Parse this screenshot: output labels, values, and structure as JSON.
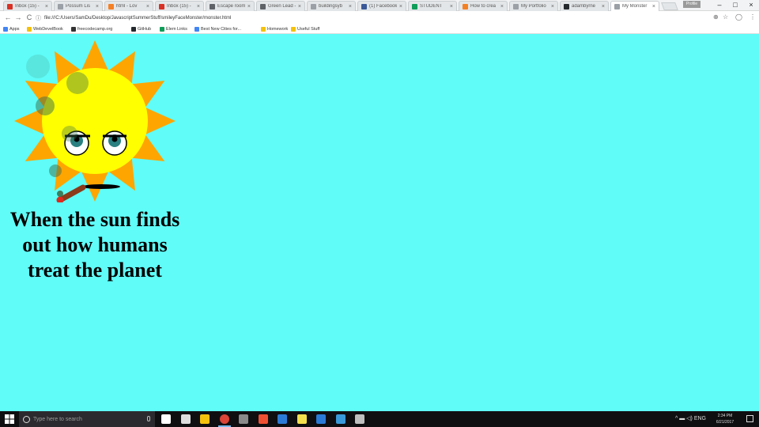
{
  "browser": {
    "tabs": [
      {
        "title": "Inbox (15) -",
        "color": "#d93025"
      },
      {
        "title": "Possum Lis",
        "color": "#9aa0a6"
      },
      {
        "title": "html - Lov",
        "color": "#f48024"
      },
      {
        "title": "Inbox (15) -",
        "color": "#d93025"
      },
      {
        "title": "Escape rooms",
        "color": "#5f6368"
      },
      {
        "title": "Green Lead -",
        "color": "#5f6368"
      },
      {
        "title": "buildingsyb",
        "color": "#9aa0a6"
      },
      {
        "title": "(1) Facebook",
        "color": "#3b5998"
      },
      {
        "title": "STUDENT",
        "color": "#0f9d58"
      },
      {
        "title": "How to crea",
        "color": "#f48024"
      },
      {
        "title": "My Portfolio",
        "color": "#9aa0a6"
      },
      {
        "title": "adambyrne",
        "color": "#24292e"
      },
      {
        "title": "My Monster",
        "color": "#9aa0a6",
        "active": true
      }
    ],
    "profile_label": "Profile",
    "window_controls": {
      "minimize": "–",
      "maximize": "□",
      "close": "×"
    },
    "nav": {
      "back": "←",
      "forward": "→",
      "reload": "C"
    },
    "url": "file:///C:/Users/SamDu/Desktop/JavascriptSummerStuff/smileyFaceMonster/monster.html",
    "info_icon": "ⓘ",
    "right_icons": [
      "⊕",
      "☆",
      "◯",
      "⋮"
    ],
    "bookmarks": [
      {
        "label": "Apps",
        "color": "#4285f4"
      },
      {
        "label": "WebDevelBook",
        "color": "#f4c20d"
      },
      {
        "label": "freecodecamp.org",
        "color": "#333333"
      },
      {
        "label": "GitHub",
        "color": "#24292e"
      },
      {
        "label": "Elem Links",
        "color": "#0f9d58"
      },
      {
        "label": "Best New Cities for...",
        "color": "#4285f4"
      },
      {
        "label": "Homework",
        "color": "#f4c20d"
      },
      {
        "label": "Useful Stuff",
        "color": "#f4c20d"
      }
    ]
  },
  "page": {
    "caption": "When the sun finds out how humans treat the planet"
  },
  "sun": {
    "ray_color": "#ffa500",
    "face_color": "#ffff00",
    "eye_white": "#ffffff",
    "iris_color": "#2a8080",
    "pupil_color": "#000000",
    "mouth_color": "#000000",
    "cigar_color": "#8b3a1a",
    "ember_color": "#e0281e",
    "smoke_color": "#3a6e4a"
  },
  "taskbar": {
    "search_placeholder": "Type here to search",
    "tray_text": "^  ▬  ◁) ENG",
    "clock_time": "2:34 PM",
    "clock_date": "6/21/2017",
    "icons": [
      {
        "name": "task-view-icon",
        "color": "#ffffff",
        "active": false
      },
      {
        "name": "people-icon",
        "color": "#dddddd",
        "active": false
      },
      {
        "name": "file-explorer-icon",
        "color": "#f4c20d",
        "active": false
      },
      {
        "name": "chrome-icon",
        "color": "#db4437",
        "active": true
      },
      {
        "name": "notepad-icon",
        "color": "#8a8a8a",
        "active": false
      },
      {
        "name": "git-icon",
        "color": "#f05032",
        "active": false
      },
      {
        "name": "visual-studio-icon",
        "color": "#2b7bd6",
        "active": false
      },
      {
        "name": "sticky-notes-icon",
        "color": "#f4e04d",
        "active": false
      },
      {
        "name": "paint-icon",
        "color": "#2b7bd6",
        "active": false
      },
      {
        "name": "layers-app-icon",
        "color": "#3a9ad9",
        "active": false
      },
      {
        "name": "settings-app-icon",
        "color": "#bfbfbf",
        "active": false
      }
    ]
  }
}
